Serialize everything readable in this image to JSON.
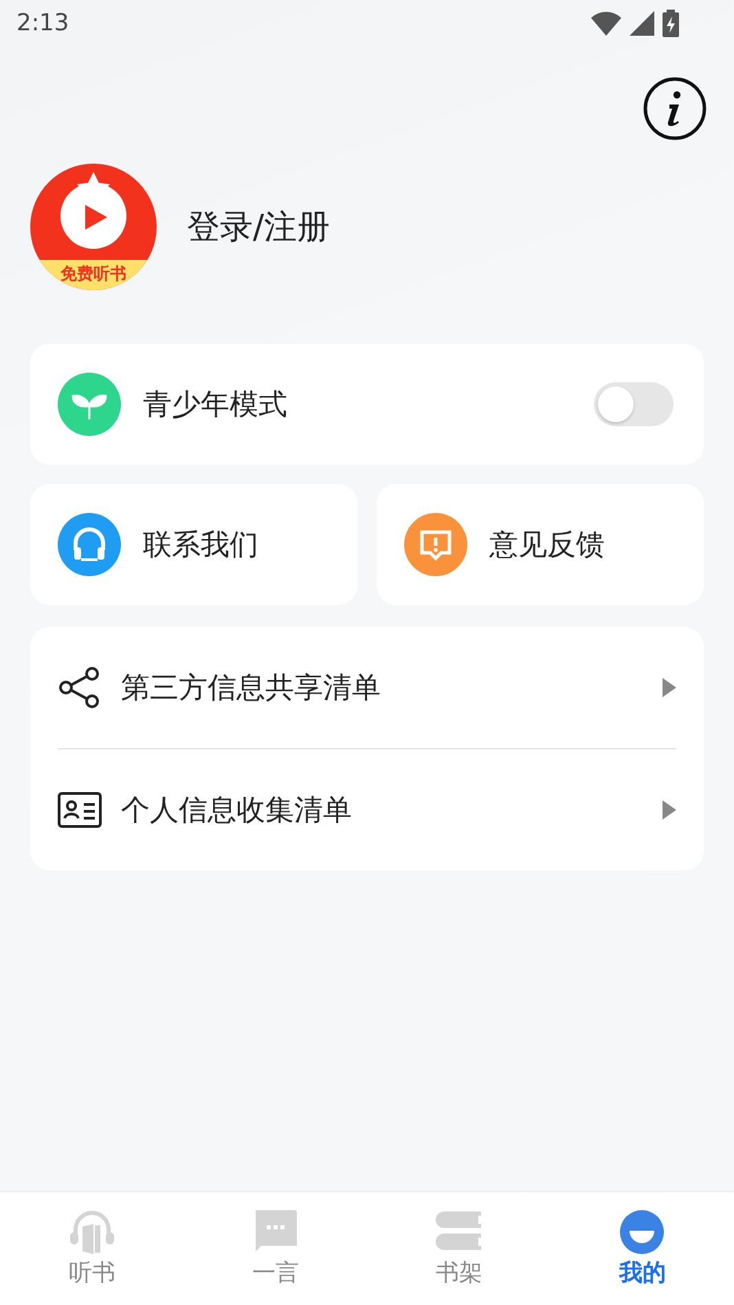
{
  "status_bar": {
    "time": "2:13"
  },
  "profile": {
    "avatar_badge": "免费听书",
    "login": "登录/注册"
  },
  "teen_mode": {
    "label": "青少年模式",
    "on": false
  },
  "shortcuts": [
    {
      "kind": "contact",
      "label": "联系我们"
    },
    {
      "kind": "feedback",
      "label": "意见反馈"
    }
  ],
  "lists": [
    {
      "kind": "share",
      "label": "第三方信息共享清单"
    },
    {
      "kind": "card",
      "label": "个人信息收集清单"
    }
  ],
  "tabs": [
    {
      "kind": "listen",
      "label": "听书",
      "selected": false
    },
    {
      "kind": "chat",
      "label": "一言",
      "selected": false
    },
    {
      "kind": "shelf",
      "label": "书架",
      "selected": false
    },
    {
      "kind": "me",
      "label": "我的",
      "selected": true
    }
  ]
}
